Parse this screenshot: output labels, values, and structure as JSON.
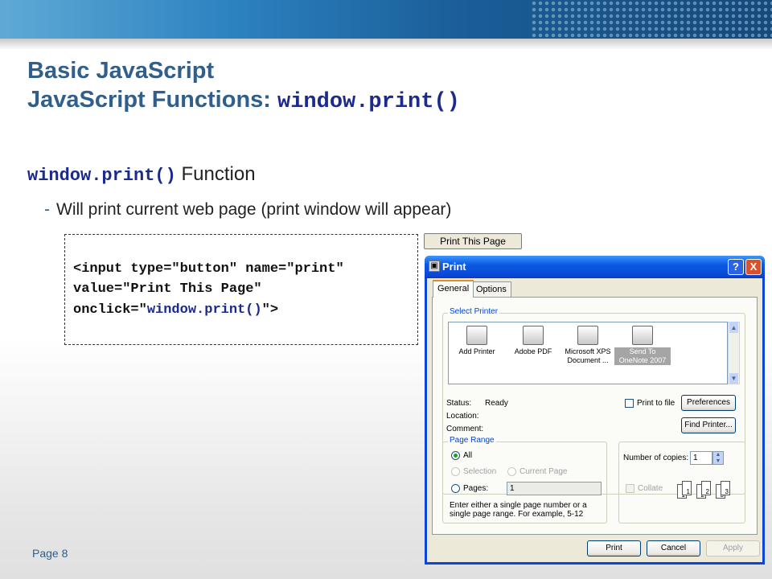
{
  "slide": {
    "title_line1": "Basic JavaScript",
    "title_line2_prefix": "JavaScript Functions: ",
    "title_line2_code": "window.print()",
    "subtitle_code": "window.print()",
    "subtitle_text": " Function",
    "bullet_dash": "-",
    "bullet_text": "Will print current web page (print window will appear)",
    "code_line1": "<input type=\"button\" name=\"print\"",
    "code_line2": "value=\"Print This Page\"",
    "code_line3_prefix": "onclick=\"",
    "code_line3_fn": "window.print()",
    "code_line3_suffix": "\">",
    "example_button": "Print This Page",
    "footer": "Page 8"
  },
  "dialog": {
    "title": "Print",
    "help": "?",
    "close": "X",
    "tabs": [
      "General",
      "Options"
    ],
    "select_printer_label": "Select Printer",
    "printers": [
      {
        "name": "Add Printer",
        "icon": "add-printer-icon"
      },
      {
        "name": "Adobe PDF",
        "icon": "printer-icon"
      },
      {
        "name": "Microsoft XPS Document ...",
        "icon": "printer-icon"
      },
      {
        "name": "Send To OneNote 2007",
        "icon": "printer-icon",
        "selected": true
      }
    ],
    "status_label": "Status:",
    "status_value": "Ready",
    "location_label": "Location:",
    "comment_label": "Comment:",
    "print_to_file": "Print to file",
    "preferences": "Preferences",
    "find_printer": "Find Printer...",
    "page_range_label": "Page Range",
    "range_all": "All",
    "range_selection": "Selection",
    "range_current": "Current Page",
    "range_pages": "Pages:",
    "pages_value": "1",
    "range_hint": "Enter either a single page number or a single page range.  For example, 5-12",
    "copies_label": "Number of copies:",
    "copies_value": "1",
    "collate": "Collate",
    "print_button": "Print",
    "cancel_button": "Cancel",
    "apply_button": "Apply"
  },
  "colors": {
    "title": "#2f5f8a",
    "code_blue": "#1c2a8c",
    "titlebar": "#0a46d8"
  }
}
